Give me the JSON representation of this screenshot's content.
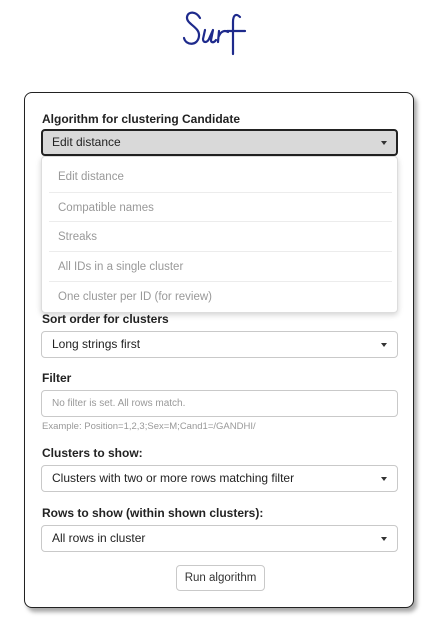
{
  "logo": {
    "text": "Surf",
    "color": "#1e2a8c"
  },
  "algorithm": {
    "label": "Algorithm for clustering Candidate",
    "value": "Edit distance",
    "options": [
      "Edit distance",
      "Compatible names",
      "Streaks",
      "All IDs in a single cluster",
      "One cluster per ID (for review)"
    ]
  },
  "sort": {
    "label": "Sort order for clusters",
    "value": "Long strings first"
  },
  "filter": {
    "label": "Filter",
    "placeholder": "No filter is set. All rows match.",
    "help": "Example: Position=1,2,3;Sex=M;Cand1=/GANDHI/"
  },
  "clusters": {
    "label": "Clusters to show:",
    "value": "Clusters with two or more rows matching filter"
  },
  "rows": {
    "label": "Rows to show (within shown clusters):",
    "value": "All rows in cluster"
  },
  "run_button": "Run algorithm"
}
